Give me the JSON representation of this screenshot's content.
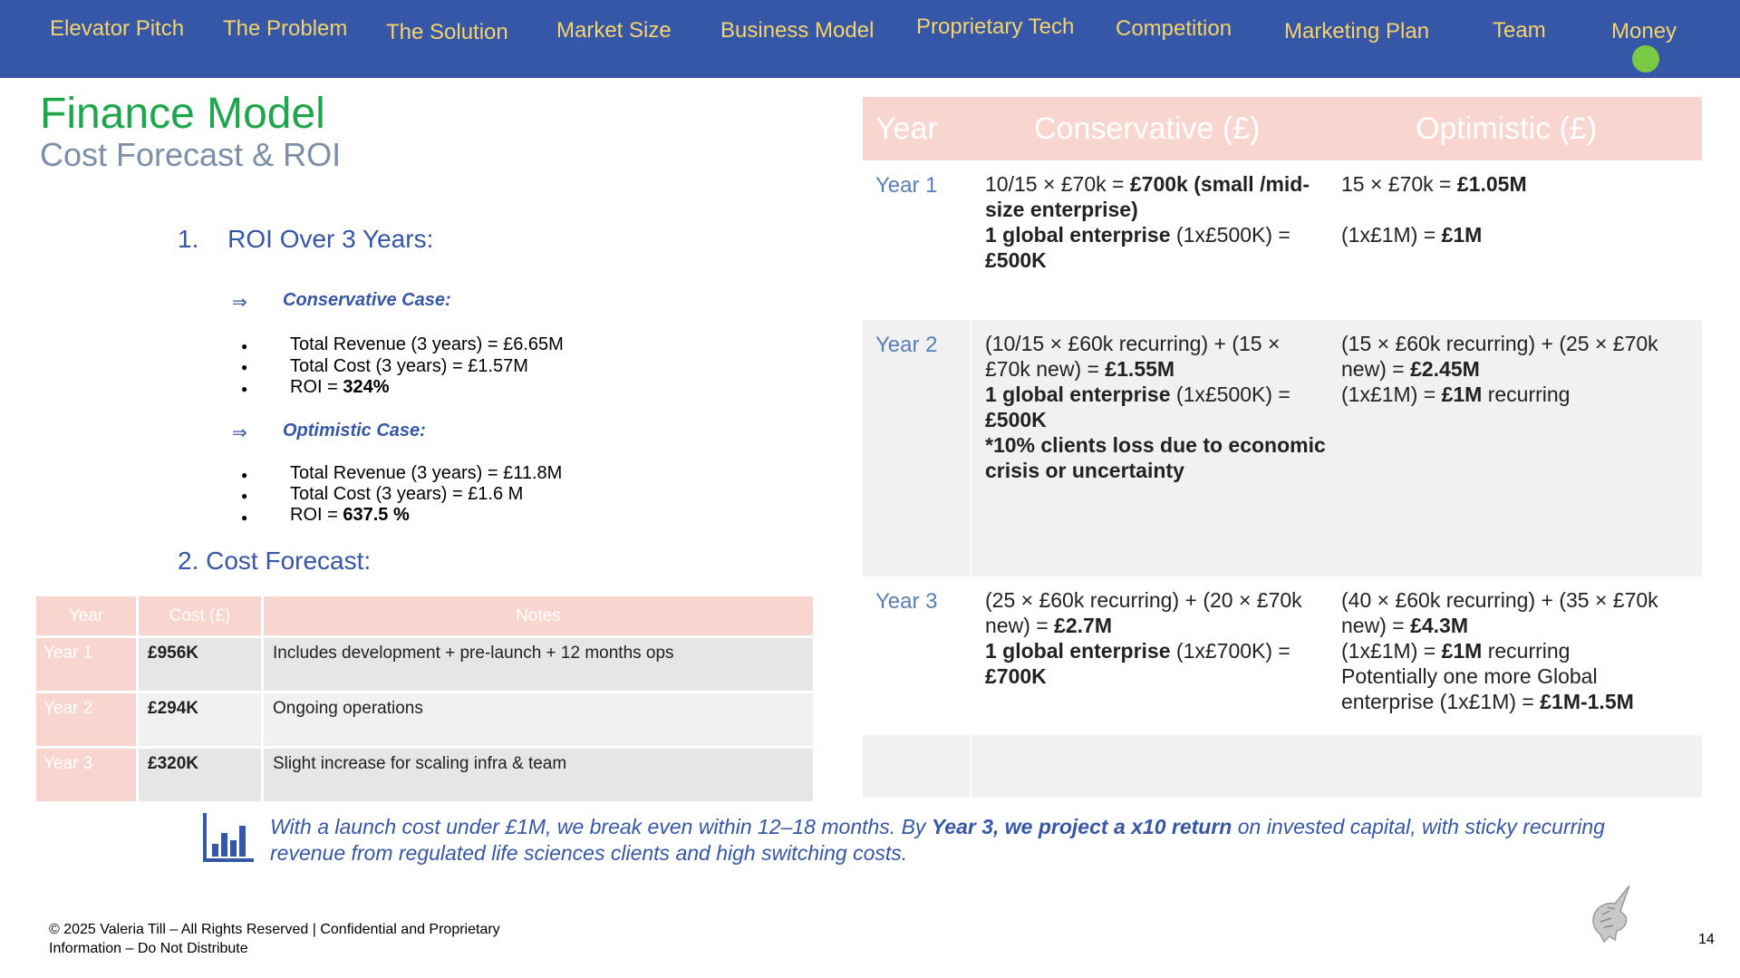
{
  "nav": {
    "items": [
      "Elevator Pitch",
      "The Problem",
      "The Solution",
      "Market Size",
      "Business Model",
      "Proprietary Tech",
      "Competition",
      "Marketing Plan",
      "Team",
      "Money"
    ]
  },
  "header": {
    "title": "Finance Model",
    "subtitle": "Cost Forecast & ROI"
  },
  "roi": {
    "heading_num": "1.",
    "heading": "ROI Over 3 Years:",
    "arrow_glyph": "⇒",
    "conservative": {
      "label": "Conservative Case:",
      "revenue": "Total Revenue (3 years) = £6.65M",
      "cost": "Total Cost (3 years) = £1.57M",
      "roi_prefix": "ROI = ",
      "roi_value": "324%"
    },
    "optimistic": {
      "label": "Optimistic Case:",
      "revenue": "Total Revenue (3 years) = £11.8M",
      "cost": "Total Cost (3 years) = £1.6 M",
      "roi_prefix": "ROI = ",
      "roi_value": "637.5 %"
    }
  },
  "cost": {
    "heading": "2. Cost Forecast:",
    "columns": [
      "Year",
      "Cost (£)",
      "Notes"
    ],
    "rows": [
      {
        "year": "Year 1",
        "cost": "£956K",
        "note": "Includes development + pre-launch + 12 months ops"
      },
      {
        "year": "Year 2",
        "cost": "£294K",
        "note": "Ongoing operations"
      },
      {
        "year": "Year 3",
        "cost": "£320K",
        "note": "Slight increase for scaling infra & team"
      }
    ]
  },
  "revenue": {
    "columns": [
      "Year",
      "Conservative (£)",
      "Optimistic (£)"
    ],
    "rows": [
      {
        "year": "Year 1",
        "cons_1a": "10/15 × £70k = ",
        "cons_1b": "£700k (small /mid-size enterprise)",
        "cons_2a": "1 global enterprise",
        "cons_2b": "  (1x£500K) = ",
        "cons_2c": "£500K",
        "opt_1a": "15 × £70k = ",
        "opt_1b": "£1.05M",
        "opt_2a": "(1x£1M) = ",
        "opt_2b": "£1M"
      },
      {
        "year": "Year 2",
        "cons_1a": "(10/15 × £60k recurring) + (15 × £70k new) = ",
        "cons_1b": "£1.55M",
        "cons_2a": "1 global enterprise",
        "cons_2b": "  (1x£500K) = ",
        "cons_2c": "£500K",
        "cons_3": "*10% clients loss due to economic crisis or uncertainty",
        "opt_1a": "(15 × £60k recurring) + (25 × £70k new) = ",
        "opt_1b": "£2.45M",
        "opt_2a": "(1x£1M) = ",
        "opt_2b": "£1M",
        "opt_2c": " recurring"
      },
      {
        "year": "Year 3",
        "cons_1a": "(25 × £60k recurring) + (20 × £70k new) = ",
        "cons_1b": "£2.7M",
        "cons_2a": "1 global enterprise",
        "cons_2b": "  (1x£700K) = ",
        "cons_2c": "£700K",
        "opt_1a": "(40 × £60k recurring) + (35 × £70k new) = ",
        "opt_1b": "£4.3M",
        "opt_2a": "(1x£1M) = ",
        "opt_2b": "£1M",
        "opt_2c": " recurring",
        "opt_3a": "Potentially one more Global enterprise (1x£1M) = ",
        "opt_3b": "£1M-1.5M"
      }
    ]
  },
  "summary": {
    "part1": "With a launch cost under £1M, we break even within 12–18 months. By ",
    "bold": "Year 3, we project a x10 return",
    "part2": " on invested capital, with sticky recurring revenue from regulated life sciences clients and high switching costs."
  },
  "footer": {
    "line1": "© 2025 Valeria Till – All Rights Reserved | Confidential and Proprietary",
    "line2": "Information – Do Not Distribute",
    "page": "14"
  },
  "colors": {
    "nav_bg": "#3656a8",
    "nav_text": "#f3d36a",
    "title_green": "#1ea64c",
    "header_pink": "#f8d6cf",
    "accent_blue": "#3656a8",
    "active_dot": "#7ac943"
  }
}
